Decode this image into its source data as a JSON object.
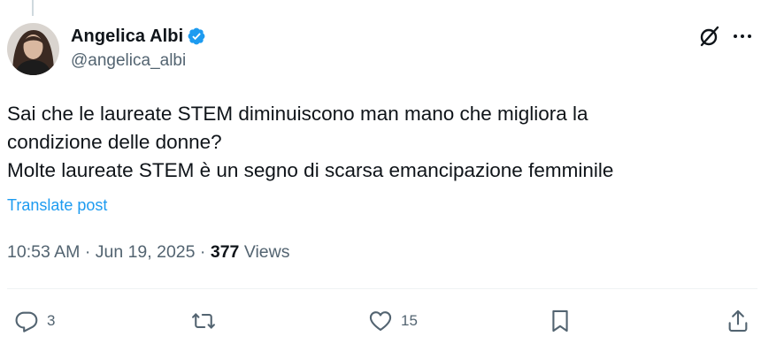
{
  "author": {
    "display_name": "Angelica Albi",
    "handle": "@angelica_albi"
  },
  "post": {
    "lines": [
      "Sai che le laureate STEM diminuiscono man mano che migliora la",
      "condizione delle donne?",
      "Molte laureate STEM è un segno di scarsa emancipazione femminile"
    ],
    "translate_label": "Translate post"
  },
  "meta": {
    "time": "10:53 AM",
    "date": "Jun 19, 2025",
    "views_count": "377",
    "views_label": "Views"
  },
  "actions": {
    "reply_count": "3",
    "like_count": "15"
  },
  "colors": {
    "accent": "#1d9bf0",
    "text": "#0f1419",
    "secondary": "#536471",
    "divider": "#eff3f4"
  },
  "icons": {
    "verified": "verified-badge-icon",
    "grok": "grok-icon",
    "more": "more-icon",
    "reply": "reply-icon",
    "repost": "repost-icon",
    "like": "like-icon",
    "bookmark": "bookmark-icon",
    "share": "share-icon"
  }
}
